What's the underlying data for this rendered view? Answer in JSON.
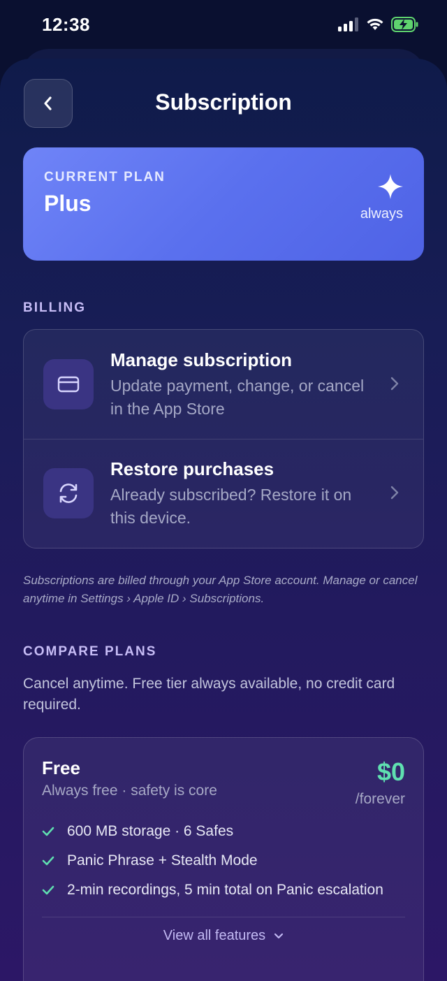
{
  "status_bar": {
    "time": "12:38"
  },
  "header": {
    "title": "Subscription"
  },
  "current_plan": {
    "kicker": "CURRENT PLAN",
    "name": "Plus",
    "tag": "always"
  },
  "billing": {
    "section_label": "BILLING",
    "items": [
      {
        "title": "Manage subscription",
        "subtitle": "Update payment, change, or cancel in the App Store",
        "icon": "credit-card-icon"
      },
      {
        "title": "Restore purchases",
        "subtitle": "Already subscribed? Restore it on this device.",
        "icon": "refresh-icon"
      }
    ],
    "footnote": "Subscriptions are billed through your App Store account. Manage or cancel anytime in Settings › Apple ID › Subscriptions."
  },
  "compare": {
    "section_label": "COMPARE PLANS",
    "description": "Cancel anytime. Free tier always available, no credit card required.",
    "free_plan": {
      "name": "Free",
      "subtitle": "Always free · safety is core",
      "price": "$0",
      "period": "/forever",
      "features": [
        "600 MB storage · 6 Safes",
        "Panic Phrase + Stealth Mode",
        "2-min recordings, 5 min total on Panic escalation"
      ],
      "view_all_label": "View all features"
    }
  },
  "colors": {
    "accent_green": "#5fe0b0",
    "plan_card": "#5a70ee",
    "section_label": "#c7bdf6"
  }
}
